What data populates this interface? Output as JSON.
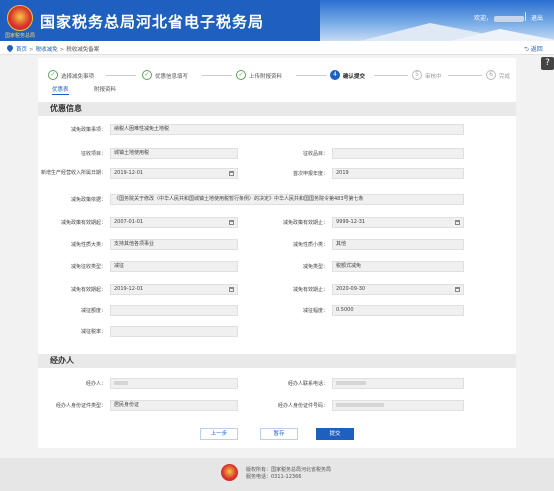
{
  "header": {
    "emblem_text": "国家税务总局",
    "title": "国家税务总局河北省电子税务局",
    "welcome": "欢迎，",
    "logout": "退出"
  },
  "breadcrumb": {
    "home": "首页",
    "level2": "税收减免",
    "current": "税收减免备案",
    "back": "返回"
  },
  "steps": [
    {
      "num": "✓",
      "label": "选择减免事项",
      "state": "done"
    },
    {
      "num": "✓",
      "label": "优惠信息填写",
      "state": "done"
    },
    {
      "num": "✓",
      "label": "上传附报资料",
      "state": "done"
    },
    {
      "num": "4",
      "label": "确认提交",
      "state": "active"
    },
    {
      "num": "5",
      "label": "审核中",
      "state": "todo"
    },
    {
      "num": "6",
      "label": "完成",
      "state": "todo"
    }
  ],
  "subtabs": {
    "tab1": "优惠表",
    "tab2": "附报资料"
  },
  "section1": {
    "title": "优惠信息",
    "fields": {
      "jmzxmc_label": "减免政策事项：",
      "jmzxmc_value": "纳税人困难性减免土地税",
      "zsxm_label": "征收项目：",
      "zsxm_value": "城镇土地使用税",
      "zspm_label": "征收品目：",
      "zspm_value": "",
      "sjsysj_label": "新增生产经营收入所属日期：",
      "sjsysj_value": "2019-12-01",
      "nssb_label": "首次申报年度：",
      "nssb_value": "2019",
      "jmzcyj_label": "减免政策依据：",
      "jmzcyj_value": "《国务院关于修改〈中华人民共和国城镇土地使用税暂行条例〉的决定》中华人民共和国国务院令第483号第七条",
      "qsrq1_label": "减免政策有效期起：",
      "qsrq1_value": "2007-01-01",
      "zzrq1_label": "减免政策有效期止：",
      "zzrq1_value": "9999-12-31",
      "jmxzdl_label": "减免性质大类：",
      "jmxzdl_value": "支持其他各项事业",
      "jmxzxl_label": "减免性质小类：",
      "jmxzxl_value": "其他",
      "jmfs_label": "减免征收类型：",
      "jmfs_value": "减征",
      "jmlx_label": "减免类型：",
      "jmlx_value": "税额式减免",
      "qsrq2_label": "减免有效期起：",
      "qsrq2_value": "2019-12-01",
      "zzrq2_label": "减免有效期止：",
      "zzrq2_value": "2020-09-30",
      "jzed_label": "减征额度：",
      "jzed_value": "",
      "jzfd_label": "减征幅度：",
      "jzfd_value": "0.5000",
      "jzsl_label": "减征税率：",
      "jzsl_value": ""
    }
  },
  "section2": {
    "title": "经办人",
    "jbr_label": "经办人：",
    "jbrdh_label": "经办人联系电话：",
    "zjlx_label": "经办人身份证件类型：",
    "zjlx_value": "居民身份证",
    "zjhm_label": "经办人身份证件号码："
  },
  "buttons": {
    "prev": "上一步",
    "save": "暂存",
    "submit": "提交"
  },
  "footer": {
    "copyright": "版权所有：国家税务总局河北省税务局",
    "hotline": "服务电话：0311-12366"
  }
}
